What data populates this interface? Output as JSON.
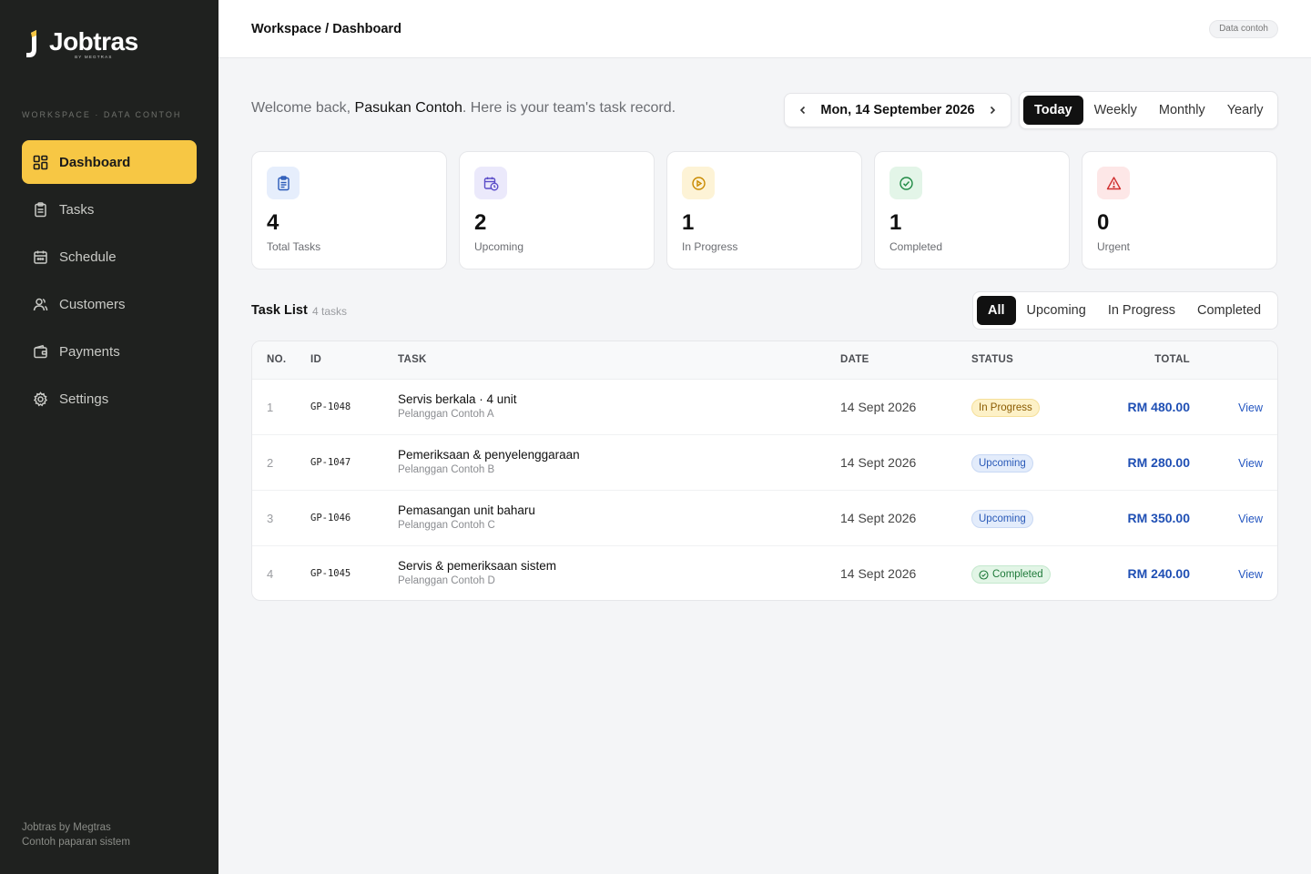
{
  "sidebar": {
    "logo_name": "Jobtras",
    "logo_sub": "BY MEGTRAS",
    "workspace_label": "WORKSPACE · DATA CONTOH",
    "items": [
      {
        "label": "Dashboard",
        "icon": "grid-icon"
      },
      {
        "label": "Tasks",
        "icon": "clipboard-icon"
      },
      {
        "label": "Schedule",
        "icon": "calendar-icon"
      },
      {
        "label": "Customers",
        "icon": "users-icon"
      },
      {
        "label": "Payments",
        "icon": "wallet-icon"
      },
      {
        "label": "Settings",
        "icon": "gear-icon"
      }
    ],
    "active": "Dashboard",
    "footer_line1": "Jobtras by Megtras",
    "footer_line2": "Contoh paparan sistem"
  },
  "topbar": {
    "breadcrumb": "Workspace / Dashboard",
    "badge": "Data contoh"
  },
  "welcome": {
    "prefix": "Welcome back, ",
    "name": "Pasukan Contoh",
    "suffix": ". Here is your team's task record."
  },
  "date_nav": {
    "date": "Mon, 14 September 2026"
  },
  "range_tabs": [
    "Today",
    "Weekly",
    "Monthly",
    "Yearly"
  ],
  "range_active": "Today",
  "stats": [
    {
      "value": "4",
      "label": "Total Tasks",
      "icon": "clipboard-list-icon",
      "bg": "#e6eefc",
      "color": "#2a5ab8"
    },
    {
      "value": "2",
      "label": "Upcoming",
      "icon": "calendar-clock-icon",
      "bg": "#ebe9fb",
      "color": "#5a4cc8"
    },
    {
      "value": "1",
      "label": "In Progress",
      "icon": "play-circle-icon",
      "bg": "#fdf3d6",
      "color": "#c98a00"
    },
    {
      "value": "1",
      "label": "Completed",
      "icon": "check-circle-icon",
      "bg": "#e3f5e8",
      "color": "#1f8a44"
    },
    {
      "value": "0",
      "label": "Urgent",
      "icon": "alert-triangle-icon",
      "bg": "#fde7e7",
      "color": "#d03030"
    }
  ],
  "task_list": {
    "title": "Task List",
    "count": "4 tasks",
    "filters": [
      "All",
      "Upcoming",
      "In Progress",
      "Completed"
    ],
    "filter_active": "All",
    "columns": [
      "NO.",
      "ID",
      "TASK",
      "DATE",
      "STATUS",
      "TOTAL"
    ],
    "rows": [
      {
        "no": "1",
        "id": "GP-1048",
        "task": "Servis berkala · 4 unit",
        "customer": "Pelanggan Contoh A",
        "date": "14 Sept 2026",
        "status": "In Progress",
        "total": "RM 480.00",
        "action": "View"
      },
      {
        "no": "2",
        "id": "GP-1047",
        "task": "Pemeriksaan & penyelenggaraan",
        "customer": "Pelanggan Contoh B",
        "date": "14 Sept 2026",
        "status": "Upcoming",
        "total": "RM 280.00",
        "action": "View"
      },
      {
        "no": "3",
        "id": "GP-1046",
        "task": "Pemasangan unit baharu",
        "customer": "Pelanggan Contoh C",
        "date": "14 Sept 2026",
        "status": "Upcoming",
        "total": "RM 350.00",
        "action": "View"
      },
      {
        "no": "4",
        "id": "GP-1045",
        "task": "Servis & pemeriksaan sistem",
        "customer": "Pelanggan Contoh D",
        "date": "14 Sept 2026",
        "status": "Completed",
        "total": "RM 240.00",
        "action": "View"
      }
    ]
  },
  "colors": {
    "sidebar_bg": "#1f211f",
    "accent_yellow": "#f7c744",
    "link_blue": "#1f4fb4"
  }
}
